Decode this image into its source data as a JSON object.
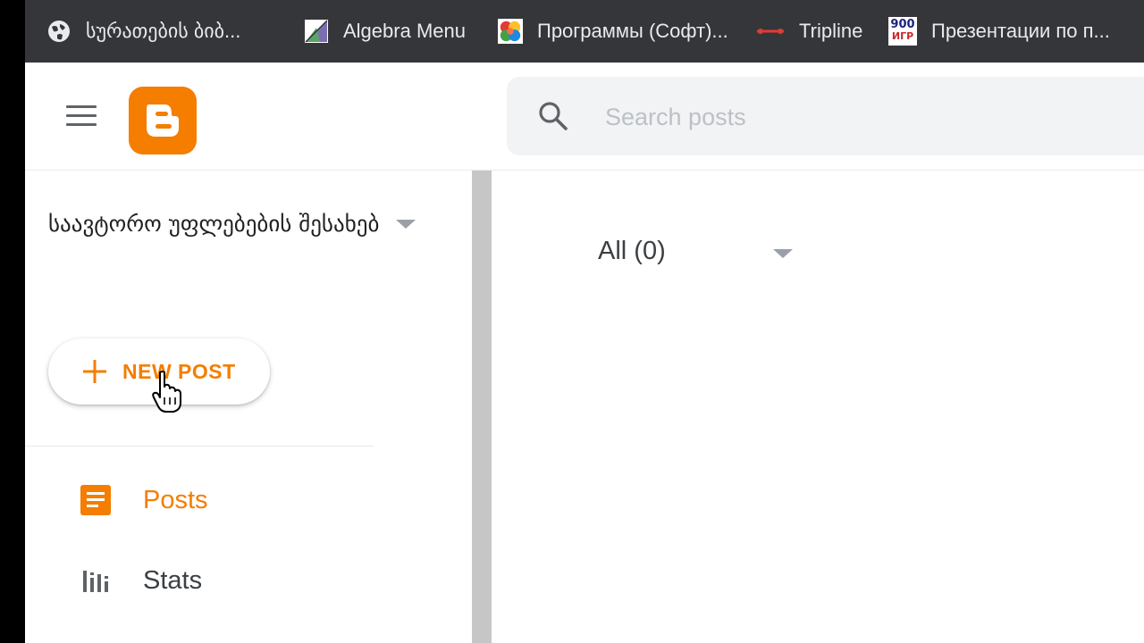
{
  "bookmarks": [
    {
      "label": "სურათების ბიბ...",
      "icon": "globe-icon"
    },
    {
      "label": "Algebra Menu",
      "icon": "algebra-icon"
    },
    {
      "label": "Программы (Софт)...",
      "icon": "puzzle-icon"
    },
    {
      "label": "Tripline",
      "icon": "tripline-icon"
    },
    {
      "label": "Презентации по п...",
      "icon": "900igr-icon",
      "icon_text_top": "900",
      "icon_text_bottom": "ИГР"
    }
  ],
  "header": {
    "menu_icon": "hamburger-menu-icon",
    "logo": "blogger-logo",
    "search_placeholder": "Search posts"
  },
  "sidebar": {
    "blog_title": "საავტორო უფლებების შესახებ",
    "new_post_label": "NEW POST",
    "nav": [
      {
        "label": "Posts",
        "icon": "posts-icon",
        "active": true
      },
      {
        "label": "Stats",
        "icon": "stats-icon",
        "active": false
      }
    ]
  },
  "main": {
    "filter_label": "All (0)"
  },
  "colors": {
    "accent": "#f57d00",
    "bookmark_bar": "#35363a",
    "text": "#202124"
  }
}
